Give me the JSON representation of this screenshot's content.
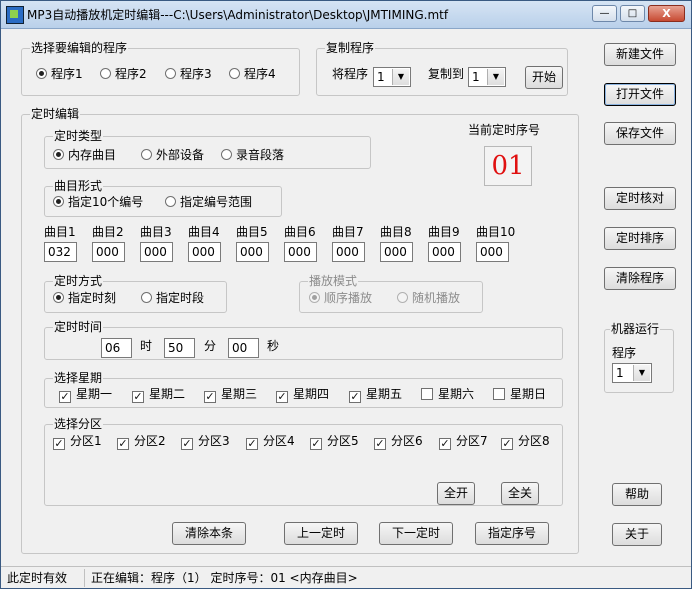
{
  "window": {
    "title": "MP3自动播放机定时编辑---C:\\Users\\Administrator\\Desktop\\JMTIMING.mtf",
    "min_glyph": "—",
    "max_glyph": "□",
    "close_glyph": "X"
  },
  "program_select": {
    "label": "选择要编辑的程序",
    "options": [
      "程序1",
      "程序2",
      "程序3",
      "程序4"
    ],
    "selected": 0
  },
  "copy_program": {
    "label": "复制程序",
    "from_label": "将程序",
    "from_value": "1",
    "to_label": "复制到",
    "to_value": "1",
    "start_label": "开始"
  },
  "right_buttons": {
    "new_file": "新建文件",
    "open_file": "打开文件",
    "save_file": "保存文件",
    "timing_check": "定时核对",
    "timing_sort": "定时排序",
    "clear_program": "清除程序",
    "help": "帮助",
    "close": "关于"
  },
  "machine_run": {
    "label": "机器运行",
    "program_label": "程序",
    "program_value": "1"
  },
  "timing_edit": {
    "label": "定时编辑",
    "current_seq_label": "当前定时序号",
    "current_seq_value": "01",
    "type": {
      "label": "定时类型",
      "options": [
        "内存曲目",
        "外部设备",
        "录音段落"
      ],
      "selected": 0
    },
    "track_form": {
      "label": "曲目形式",
      "options": [
        "指定10个编号",
        "指定编号范围"
      ],
      "selected": 0
    },
    "tracks": [
      {
        "label": "曲目1",
        "value": "032"
      },
      {
        "label": "曲目2",
        "value": "000"
      },
      {
        "label": "曲目3",
        "value": "000"
      },
      {
        "label": "曲目4",
        "value": "000"
      },
      {
        "label": "曲目5",
        "value": "000"
      },
      {
        "label": "曲目6",
        "value": "000"
      },
      {
        "label": "曲目7",
        "value": "000"
      },
      {
        "label": "曲目8",
        "value": "000"
      },
      {
        "label": "曲目9",
        "value": "000"
      },
      {
        "label": "曲目10",
        "value": "000"
      }
    ],
    "mode": {
      "label": "定时方式",
      "options": [
        "指定时刻",
        "指定时段"
      ],
      "selected": 0
    },
    "play_mode": {
      "label": "播放模式",
      "options": [
        "顺序播放",
        "随机播放"
      ],
      "selected": 0
    },
    "time": {
      "label": "定时时间",
      "hour": "06",
      "hour_unit": "时",
      "minute": "50",
      "minute_unit": "分",
      "second": "00",
      "second_unit": "秒"
    },
    "weekdays": {
      "label": "选择星期",
      "items": [
        {
          "label": "星期一",
          "checked": true
        },
        {
          "label": "星期二",
          "checked": true
        },
        {
          "label": "星期三",
          "checked": true
        },
        {
          "label": "星期四",
          "checked": true
        },
        {
          "label": "星期五",
          "checked": true
        },
        {
          "label": "星期六",
          "checked": false
        },
        {
          "label": "星期日",
          "checked": false
        }
      ]
    },
    "zones": {
      "label": "选择分区",
      "items": [
        {
          "label": "分区1",
          "checked": true
        },
        {
          "label": "分区2",
          "checked": true
        },
        {
          "label": "分区3",
          "checked": true
        },
        {
          "label": "分区4",
          "checked": true
        },
        {
          "label": "分区5",
          "checked": true
        },
        {
          "label": "分区6",
          "checked": true
        },
        {
          "label": "分区7",
          "checked": true
        },
        {
          "label": "分区8",
          "checked": true
        }
      ],
      "all_on": "全开",
      "all_off": "全关"
    },
    "bottom_buttons": {
      "clear_entry": "清除本条",
      "prev": "上一定时",
      "next": "下一定时",
      "go_seq": "指定序号"
    }
  },
  "status": {
    "pane1": "此定时有效",
    "pane2": "正在编辑：程序（1）  定时序号：01  <内存曲目>"
  }
}
